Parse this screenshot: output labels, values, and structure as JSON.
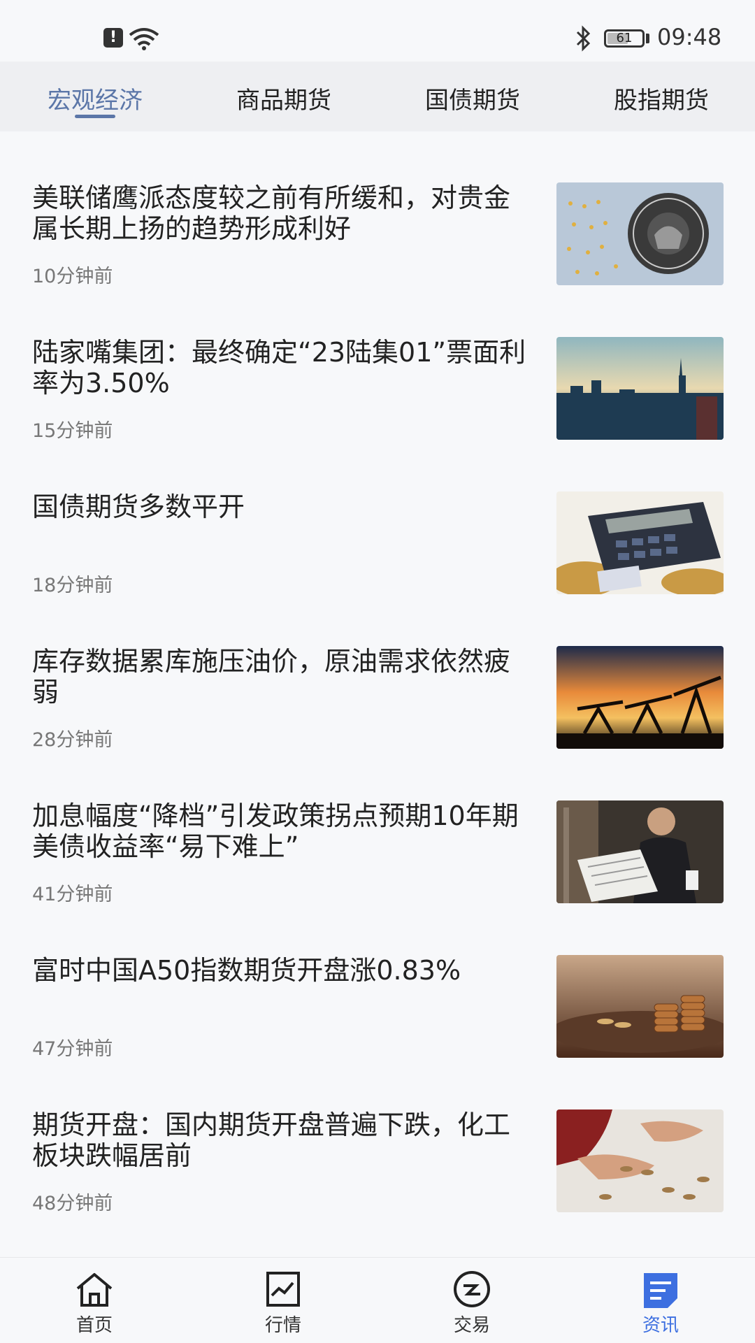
{
  "status_bar": {
    "time": "09:48",
    "battery": "61",
    "battery_level": 0.61
  },
  "tabs": [
    {
      "label": "宏观经济",
      "active": true
    },
    {
      "label": "商品期货",
      "active": false
    },
    {
      "label": "国债期货",
      "active": false
    },
    {
      "label": "股指期货",
      "active": false
    }
  ],
  "news": [
    {
      "title": "美联储鹰派态度较之前有所缓和，对贵金属长期上扬的趋势形成利好",
      "time": "10分钟前",
      "thumb": "federal-reserve-seal"
    },
    {
      "title": "陆家嘴集团：最终确定“23陆集01”票面利率为3.50%",
      "time": "15分钟前",
      "thumb": "city-skyline"
    },
    {
      "title": "国债期货多数平开",
      "time": "18分钟前",
      "thumb": "calculator-coins"
    },
    {
      "title": "库存数据累库施压油价，原油需求依然疲弱",
      "time": "28分钟前",
      "thumb": "oil-pumps-sunset"
    },
    {
      "title": "加息幅度“降档”引发政策拐点预期10年期美债收益率“易下难上”",
      "time": "41分钟前",
      "thumb": "man-reading-newspaper"
    },
    {
      "title": "富时中国A50指数期货开盘涨0.83%",
      "time": "47分钟前",
      "thumb": "coin-stacks"
    },
    {
      "title": "期货开盘：国内期货开盘普遍下跌，化工板块跌幅居前",
      "time": "48分钟前",
      "thumb": "hand-with-coins"
    }
  ],
  "bottom_nav": [
    {
      "label": "首页",
      "icon": "home-icon",
      "active": false
    },
    {
      "label": "行情",
      "icon": "chart-icon",
      "active": false
    },
    {
      "label": "交易",
      "icon": "trade-icon",
      "active": false
    },
    {
      "label": "资讯",
      "icon": "news-icon",
      "active": true
    }
  ],
  "colors": {
    "accent": "#5b76a8",
    "nav_active": "#3d6fe0",
    "background": "#f7f8fa",
    "tab_bar": "#eeeff2"
  }
}
